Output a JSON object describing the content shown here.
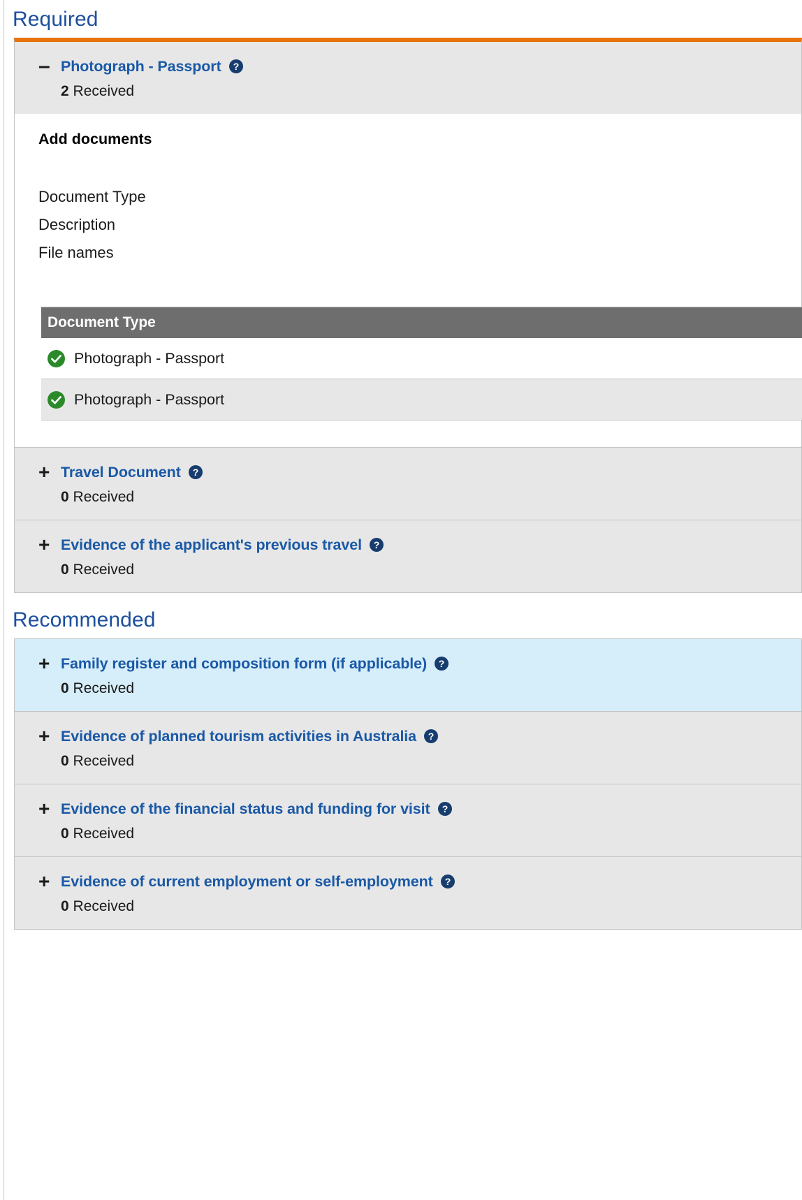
{
  "sections": [
    {
      "heading": "Required",
      "accent_color": "#e8720c",
      "has_accent_bar": true,
      "items": [
        {
          "title": "Photograph - Passport",
          "toggle": "minus",
          "expanded": true,
          "count": "2",
          "count_label": "Received",
          "highlight": false,
          "help_icon": "help-circle-icon",
          "body": {
            "title": "Add documents",
            "fields": [
              "Document Type",
              "Description",
              "File names"
            ],
            "table": {
              "columns": [
                "Document Type"
              ],
              "rows": [
                {
                  "status_icon": "check-circle-icon",
                  "document_type": "Photograph - Passport"
                },
                {
                  "status_icon": "check-circle-icon",
                  "document_type": "Photograph - Passport"
                }
              ]
            }
          }
        },
        {
          "title": "Travel Document",
          "toggle": "plus",
          "expanded": false,
          "count": "0",
          "count_label": "Received",
          "highlight": false,
          "help_icon": "help-circle-icon"
        },
        {
          "title": "Evidence of the applicant's previous travel",
          "toggle": "plus",
          "expanded": false,
          "count": "0",
          "count_label": "Received",
          "highlight": false,
          "help_icon": "help-circle-icon"
        }
      ]
    },
    {
      "heading": "Recommended",
      "accent_color": "#c4c4c4",
      "has_accent_bar": false,
      "items": [
        {
          "title": "Family register and composition form (if applicable)",
          "toggle": "plus",
          "expanded": false,
          "count": "0",
          "count_label": "Received",
          "highlight": true,
          "help_icon": "help-circle-icon"
        },
        {
          "title": "Evidence of planned tourism activities in Australia",
          "toggle": "plus",
          "expanded": false,
          "count": "0",
          "count_label": "Received",
          "highlight": false,
          "help_icon": "help-circle-icon"
        },
        {
          "title": "Evidence of the financial status and funding for visit",
          "toggle": "plus",
          "expanded": false,
          "count": "0",
          "count_label": "Received",
          "highlight": false,
          "help_icon": "help-circle-icon"
        },
        {
          "title": "Evidence of current employment or self-employment",
          "toggle": "plus",
          "expanded": false,
          "count": "0",
          "count_label": "Received",
          "highlight": false,
          "help_icon": "help-circle-icon"
        }
      ]
    }
  ],
  "glyphs": {
    "plus": "+",
    "minus": "–"
  },
  "colors": {
    "link_blue": "#1a59a6",
    "heading_blue": "#1c4f9c",
    "accent_orange": "#e8720c",
    "check_green": "#2a8a2a",
    "help_navy": "#173c6e",
    "table_header_gray": "#6e6e6e",
    "row_gray": "#e7e7e7",
    "highlight_blue": "#d6edfa"
  }
}
